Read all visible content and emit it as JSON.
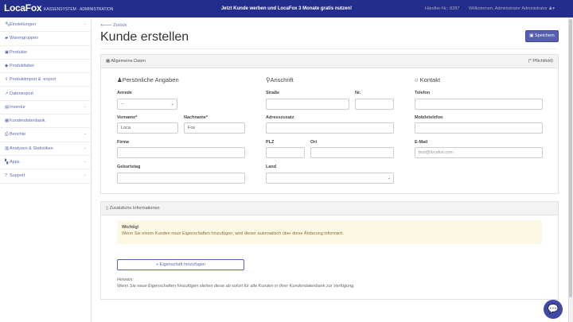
{
  "topbar": {
    "logo": "LocaFox",
    "subtitle": "KASSENSYSTEM · ADMINISTRATION",
    "promo": "Jetzt Kunde werben und LocaFox 3 Monate gratis nutzen!",
    "dealer": "Händler-Nr.: 8287",
    "welcome": "Willkommen, Administrator Administrator"
  },
  "sidebar": {
    "items": [
      {
        "label": "Einstellungen",
        "icon": "wrench-icon",
        "glyph": "🔧",
        "sub": true
      },
      {
        "label": "Warengruppen",
        "icon": "folder-icon",
        "glyph": "▰",
        "sub": false
      },
      {
        "label": "Produkte",
        "icon": "basket-icon",
        "glyph": "▣",
        "sub": false
      },
      {
        "label": "Produktlabel",
        "icon": "tags-icon",
        "glyph": "◆",
        "sub": false
      },
      {
        "label": "Produktimport & -export",
        "icon": "upload-icon",
        "glyph": "⇪",
        "sub": false
      },
      {
        "label": "Datenexport",
        "icon": "export-icon",
        "glyph": "↗",
        "sub": false
      },
      {
        "label": "Inventur",
        "icon": "clipboard-icon",
        "glyph": "▤",
        "sub": true
      },
      {
        "label": "Kundendatenbank",
        "icon": "address-card-icon",
        "glyph": "▦",
        "sub": false
      },
      {
        "label": "Berichte",
        "icon": "print-icon",
        "glyph": "⎙",
        "sub": true
      },
      {
        "label": "Analysen & Statistiken",
        "icon": "chart-icon",
        "glyph": "▥",
        "sub": true
      },
      {
        "label": "Apps",
        "icon": "cubes-icon",
        "glyph": "▚",
        "sub": true
      },
      {
        "label": "Support",
        "icon": "question-icon",
        "glyph": "?",
        "sub": true
      }
    ]
  },
  "page": {
    "back": "Zurück",
    "title": "Kunde erstellen",
    "save": "Speichern"
  },
  "general": {
    "header": "Allgemeine Daten",
    "required_note": "(* Pflichtfeld)",
    "personal": "Persönliche Angaben",
    "address": "Anschrift",
    "contact": "Kontakt",
    "anrede_label": "Anrede",
    "anrede_value": "--",
    "vorname_label": "Vorname*",
    "vorname_value": "Loca",
    "nachname_label": "Nachname*",
    "nachname_value": "Fox",
    "firma_label": "Firma",
    "geburtstag_label": "Geburtstag",
    "strasse_label": "Straße",
    "nr_label": "Nr.",
    "adresszusatz_label": "Adresszusatz",
    "plz_label": "PLZ",
    "ort_label": "Ort",
    "land_label": "Land",
    "telefon_label": "Telefon",
    "mobil_label": "Mobiletelefon",
    "email_label": "E-Mail",
    "email_placeholder": "test@locafox.com"
  },
  "additional": {
    "header": "Zusätzliche Informationen",
    "alert_title": "Wichtig!",
    "alert_text": "Wenn Sie einem Kunden neue Eigenschaften hinzufügen, wird dieser automatisch über diese Änderung informiert.",
    "add_button": "Eigenschaft hinzufügen",
    "hint_title": "Hinweis:",
    "hint_text": "Wenn Sie neue Eigenschaften hinzufügen stehen diese ab sofort für alle Kunden in Ihrer Kundendatenbank zur Verfügung."
  }
}
